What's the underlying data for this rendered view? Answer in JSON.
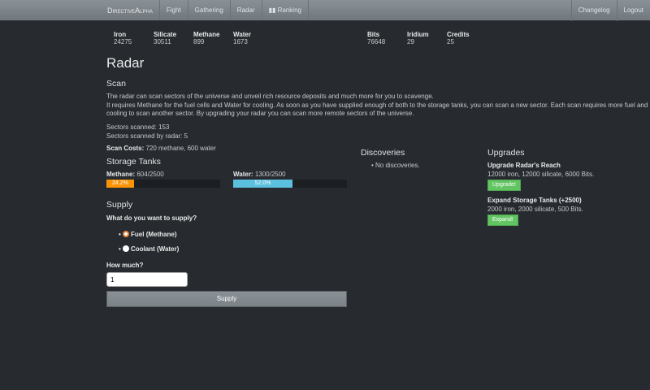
{
  "nav": {
    "brand": "DirectiveAlpha",
    "items": [
      "Fight",
      "Gathering",
      "Radar",
      "Ranking"
    ],
    "right": [
      "Changelog",
      "Logout"
    ]
  },
  "resources": [
    {
      "label": "Iron",
      "value": "24275"
    },
    {
      "label": "Silicate",
      "value": "30511"
    },
    {
      "label": "Methane",
      "value": "899"
    },
    {
      "label": "Water",
      "value": "1673"
    },
    {
      "label": "Bits",
      "value": "76648"
    },
    {
      "label": "Iridium",
      "value": "29"
    },
    {
      "label": "Credits",
      "value": "25"
    }
  ],
  "title": "Radar",
  "scan": {
    "heading": "Scan",
    "desc1": "The radar can scan sectors of the universe and unveil rich resource deposits and much more for you to scavenge.",
    "desc2": "It requires Methane for the fuel cells and Water for cooling. As soon as you have supplied enough of both to the storage tanks, you can scan a new sector. Each scan requires more fuel and cooling to scan another sector. By upgrading your radar you can scan more remote sectors of the universe.",
    "scanned": "Sectors scanned: 153",
    "scanned_radar": "Sectors scanned by radar: 5",
    "cost_label": "Scan Costs:",
    "cost_value": " 720 methane, 600 water"
  },
  "tanks": {
    "heading": "Storage Tanks",
    "methane": {
      "label": "Methane:",
      "value": " 604/2500",
      "percent": 24.2,
      "text": "24.2%",
      "color": "#f89406"
    },
    "water": {
      "label": "Water:",
      "value": " 1300/2500",
      "percent": 52.0,
      "text": "52.0%",
      "color": "#5bc0de"
    }
  },
  "supply": {
    "heading": "Supply",
    "question": "What do you want to supply?",
    "options": [
      "Fuel (Methane)",
      "Coolant (Water)"
    ],
    "selected": 0,
    "amount_label": "How much?",
    "amount": "1",
    "button": "Supply"
  },
  "discoveries": {
    "heading": "Discoveries",
    "items": [
      "No discoveries."
    ]
  },
  "upgrades": {
    "heading": "Upgrades",
    "items": [
      {
        "title": "Upgrade Radar's Reach",
        "cost": "12000 iron, 12000 silicate, 6000 Bits.",
        "button": "Upgrade!"
      },
      {
        "title": "Expand Storage Tanks (+2500)",
        "cost": "2000 iron, 2000 silicate, 500 Bits.",
        "button": "Expand!"
      }
    ]
  }
}
